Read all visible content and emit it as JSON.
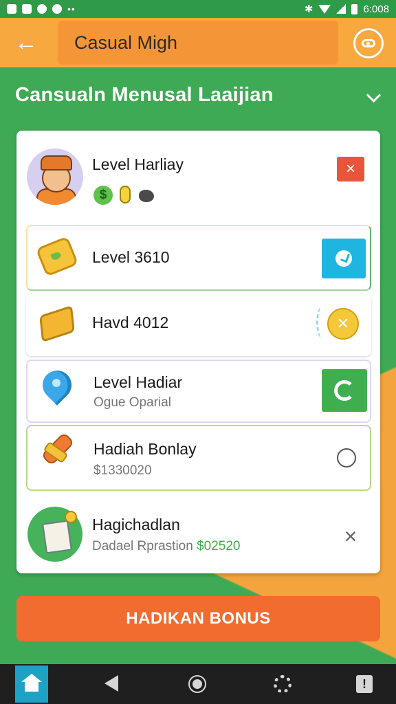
{
  "status_bar": {
    "time": "6:008",
    "dots": "••"
  },
  "header": {
    "title": "Casual Migh"
  },
  "section": {
    "title": "Cansualn Menusal Laaijian"
  },
  "profile": {
    "name": "Level Harliay",
    "badge_dollar": "$"
  },
  "items": [
    {
      "title": "Level 3610",
      "subtitle": ""
    },
    {
      "title": "Havd 4012",
      "subtitle": ""
    },
    {
      "title": "Level Hadiar",
      "subtitle": "Ogue Oparial"
    },
    {
      "title": "Hadiah Bonlay",
      "subtitle": "$1330020"
    }
  ],
  "last_item": {
    "title": "Hagichadlan",
    "subtitle": "Dadael Rprastion",
    "price": "$02520"
  },
  "cta": {
    "label": "HADIKAN BONUS"
  },
  "icons": {
    "close": "×",
    "coin_symbol": "✕",
    "info": "!"
  },
  "colors": {
    "green_bg": "#3faa55",
    "orange_header": "#f7a83e",
    "cta_orange": "#f26b2f",
    "accent_blue": "#1fb5e1",
    "accent_green": "#3fae4f",
    "close_red": "#e8553a"
  }
}
